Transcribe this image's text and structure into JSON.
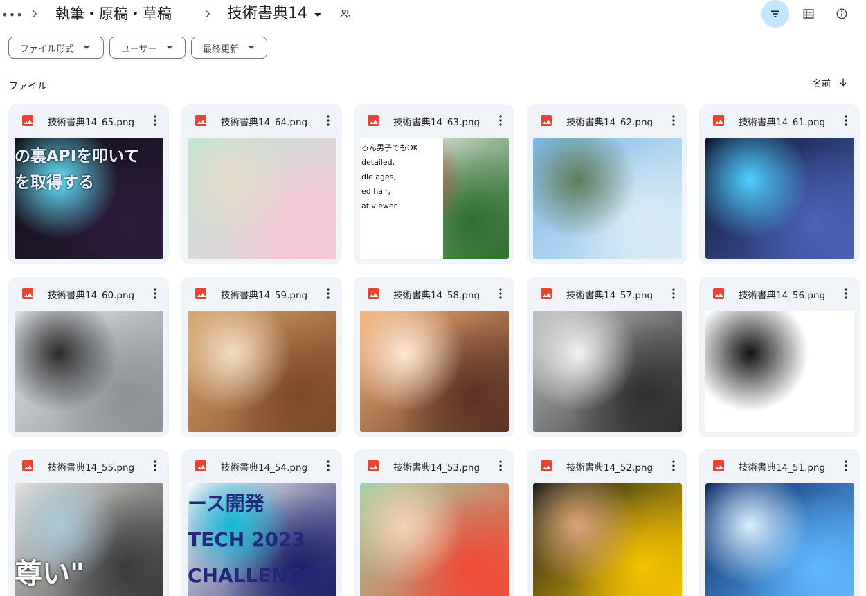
{
  "breadcrumb": {
    "more": "•••",
    "parent": "執筆・原稿・草稿",
    "current": "技術書典14"
  },
  "filters": {
    "type": "ファイル形式",
    "people": "ユーザー",
    "modified": "最終更新"
  },
  "section": {
    "label": "ファイル"
  },
  "sort": {
    "label": "名前"
  },
  "files": [
    {
      "name": "技術書典14_65.png",
      "thumb": {
        "colors": [
          "#121016",
          "#2a1b3a",
          "#66e3ff"
        ],
        "text": "の裏APIを叩いて\nを取得する",
        "text_color": "#e9f2ff"
      }
    },
    {
      "name": "技術書典14_64.png",
      "thumb": {
        "colors": [
          "#bfe6d5",
          "#f6c8d6",
          "#e7dccc"
        ],
        "text": "",
        "text_color": ""
      }
    },
    {
      "name": "技術書典14_63.png",
      "thumb": {
        "colors": [
          "#ffffff",
          "#2e6f2e",
          "#c22a1d"
        ],
        "text": "ろん男子でもOK\ndetailed,\ndle ages,\ned hair,\nat viewer",
        "text_color": "#111111"
      }
    },
    {
      "name": "技術書典14_62.png",
      "thumb": {
        "colors": [
          "#7cb9e6",
          "#d9ecf7",
          "#5f7d5c"
        ],
        "text": "",
        "text_color": ""
      }
    },
    {
      "name": "技術書典14_61.png",
      "thumb": {
        "colors": [
          "#0d1730",
          "#4a62b8",
          "#4fd0ff"
        ],
        "text": "",
        "text_color": ""
      }
    },
    {
      "name": "技術書典14_60.png",
      "thumb": {
        "colors": [
          "#dfe3e6",
          "#8c9296",
          "#2b2b2b"
        ],
        "text": "",
        "text_color": ""
      }
    },
    {
      "name": "技術書典14_59.png",
      "thumb": {
        "colors": [
          "#d6a56d",
          "#7d4a27",
          "#f3dcc1"
        ],
        "text": "",
        "text_color": ""
      }
    },
    {
      "name": "技術書典14_58.png",
      "thumb": {
        "colors": [
          "#f6b37a",
          "#5a3322",
          "#fde8d0"
        ],
        "text": "",
        "text_color": ""
      }
    },
    {
      "name": "技術書典14_57.png",
      "thumb": {
        "colors": [
          "#bfbfbf",
          "#2f2f2f",
          "#f1f1f1"
        ],
        "text": "",
        "text_color": ""
      }
    },
    {
      "name": "技術書典14_56.png",
      "thumb": {
        "colors": [
          "#ffffff",
          "#ffffff",
          "#111111"
        ],
        "text": "",
        "text_color": ""
      }
    },
    {
      "name": "技術書典14_55.png",
      "thumb": {
        "colors": [
          "#e7e4de",
          "#3b3b3b",
          "#a8c7d8"
        ],
        "text": "尊い\"",
        "text_color": "#ffffff"
      }
    },
    {
      "name": "技術書典14_54.png",
      "thumb": {
        "colors": [
          "#ffffff",
          "#1b1f66",
          "#13b8d4"
        ],
        "text": "ース開発\nTECH 2023\nCHALLENGE",
        "text_color": "#1f2a7a"
      }
    },
    {
      "name": "技術書典14_53.png",
      "thumb": {
        "colors": [
          "#9ed3a3",
          "#ee4a37",
          "#f5d2b3"
        ],
        "text": "",
        "text_color": ""
      }
    },
    {
      "name": "技術書典14_52.png",
      "thumb": {
        "colors": [
          "#1d1d1d",
          "#f4c300",
          "#d9a57a"
        ],
        "text": "",
        "text_color": ""
      }
    },
    {
      "name": "技術書典14_51.png",
      "thumb": {
        "colors": [
          "#0b2a66",
          "#5fb7ff",
          "#d8f0ff"
        ],
        "text": "",
        "text_color": ""
      }
    }
  ]
}
